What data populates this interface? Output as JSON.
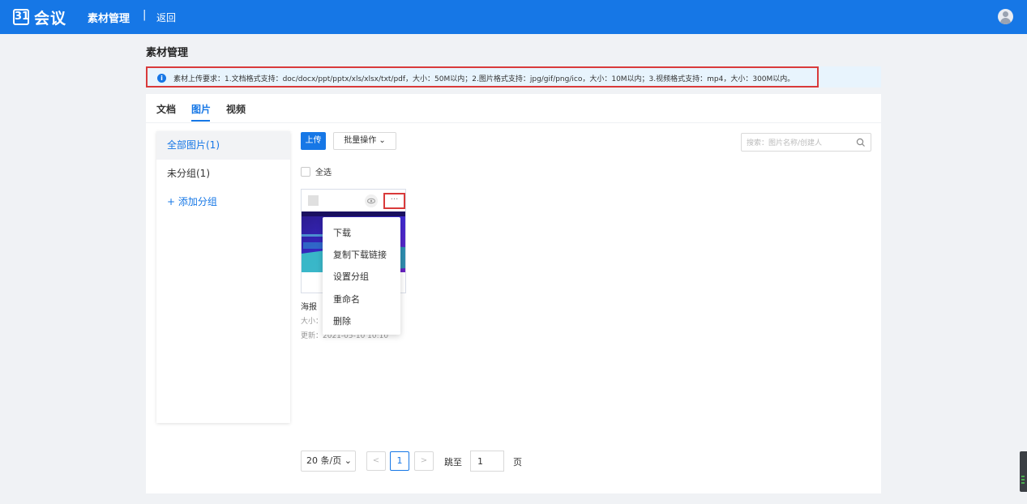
{
  "topbar": {
    "logo_mark": "31",
    "logo_text": "会议",
    "title": "素材管理",
    "separator": "|",
    "back": "返回"
  },
  "page": {
    "title": "素材管理"
  },
  "notice": {
    "text": "素材上传要求：1.文档格式支持：doc/docx/ppt/pptx/xls/xlsx/txt/pdf，大小：50M以内；2.图片格式支持：jpg/gif/png/ico，大小：10M以内；3.视频格式支持：mp4，大小：300M以内。"
  },
  "tabs": [
    {
      "label": "文档"
    },
    {
      "label": "图片"
    },
    {
      "label": "视频"
    }
  ],
  "groups": {
    "all": "全部图片(1)",
    "ungrouped": "未分组(1)",
    "add": "+ 添加分组"
  },
  "toolbar": {
    "upload": "上传",
    "batch": "批量操作 ⌄",
    "search_placeholder": "搜索：图片名称/创建人",
    "select_all": "全选"
  },
  "card": {
    "name": "海报",
    "size": "大小：",
    "updated": "更新：2021-05-10 10:10",
    "more": "···"
  },
  "menu": [
    "下载",
    "复制下载链接",
    "设置分组",
    "重命名",
    "删除"
  ],
  "pager": {
    "page_size": "20 条/页 ⌄",
    "prev": "<",
    "current": "1",
    "next": ">",
    "goto_label": "跳至",
    "goto_value": "1",
    "page_label": "页"
  },
  "colors": {
    "primary": "#1677e6",
    "highlight_border": "#d93a3a"
  }
}
